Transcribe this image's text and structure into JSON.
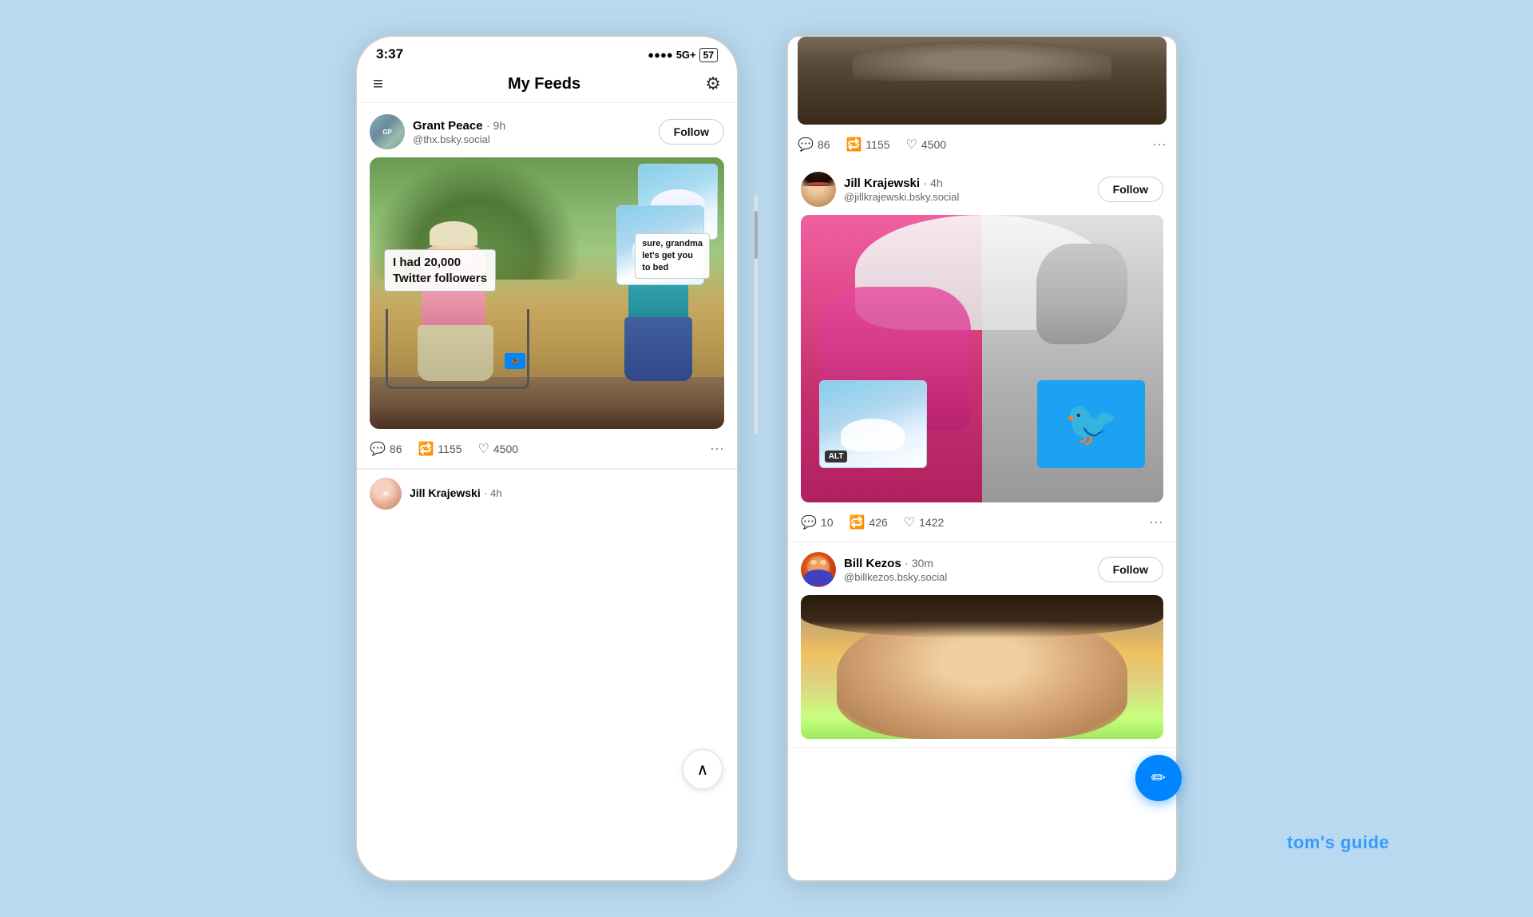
{
  "background_color": "#b8d9f0",
  "phone_left": {
    "status_bar": {
      "time": "3:37",
      "signal": "●●●●",
      "network": "5G+",
      "battery": "57"
    },
    "nav": {
      "title": "My Feeds",
      "menu_icon": "≡",
      "settings_icon": "⚙"
    },
    "post1": {
      "user_name": "Grant Peace",
      "time_ago": "· 9h",
      "handle": "@thx.bsky.social",
      "follow_label": "Follow",
      "meme_text_1": "I had 20,000\nTwitter followers",
      "meme_text_2": "sure, grandma\nlet's get you\nto bed",
      "replies": "86",
      "retweets": "1155",
      "likes": "4500"
    }
  },
  "phone_right": {
    "post_top": {
      "replies": "86",
      "retweets": "1155",
      "likes": "4500"
    },
    "post_jill": {
      "user_name": "Jill Krajewski",
      "time_ago": "· 4h",
      "handle": "@jillkrajewski.bsky.social",
      "follow_label": "Follow",
      "alt_text": "ALT",
      "replies": "10",
      "retweets": "426",
      "likes": "1422"
    },
    "post_bill": {
      "user_name": "Bill Kezos",
      "time_ago": "· 30m",
      "handle": "@billkezos.bsky.social",
      "follow_label": "Follow"
    }
  },
  "toms_guide": {
    "text": "tom's guide"
  },
  "icons": {
    "menu": "≡",
    "settings": "⚙",
    "reply": "💬",
    "retweet": "🔁",
    "like": "♡",
    "more": "···",
    "up": "∧",
    "compose": "✏",
    "twitter_bird": "🐦"
  }
}
